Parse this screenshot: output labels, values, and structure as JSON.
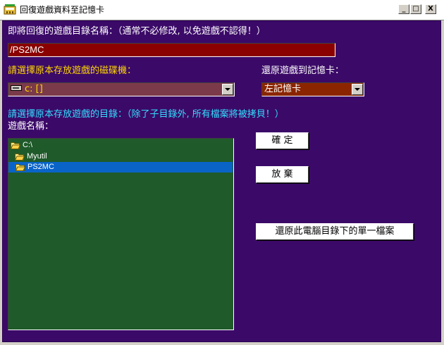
{
  "window": {
    "title": "回復遊戲資料至記憶卡",
    "minimize_label": "_",
    "maximize_label": "□",
    "close_label": "X"
  },
  "form": {
    "dir_name_label": "即將回復的遊戲目錄名稱：（通常不必修改, 以免遊戲不認得！）",
    "dir_name_value": "/PS2MC",
    "drive_label": "請選擇原本存放遊戲的磁碟機：",
    "drive_value": "c: []",
    "restore_to_label": "還原遊戲到記憶卡：",
    "memory_card_value": "左記憶卡",
    "dir_select_label": "請選擇原本存放遊戲的目錄：（除了子目錄外, 所有檔案將被拷貝！）",
    "game_name_label": "遊戲名稱："
  },
  "tree": {
    "items": [
      {
        "label": "C:\\",
        "selected": false
      },
      {
        "label": "Myutil",
        "selected": false
      },
      {
        "label": "PS2MC",
        "selected": true
      }
    ]
  },
  "buttons": {
    "confirm": "確 定",
    "cancel": "放 棄",
    "restore_single": "還原此電腦目錄下的單一檔案"
  },
  "colors": {
    "client_bg": "#3b0a68",
    "input_bg": "#8b0000",
    "tree_bg": "#1f5a2a",
    "selection": "#0a64c8",
    "label_yellow": "#ffd700",
    "label_cyan": "#33ddff"
  },
  "icons": {
    "app": "memory-card-icon",
    "drive": "hard-drive-icon",
    "folder": "folder-open-icon"
  }
}
